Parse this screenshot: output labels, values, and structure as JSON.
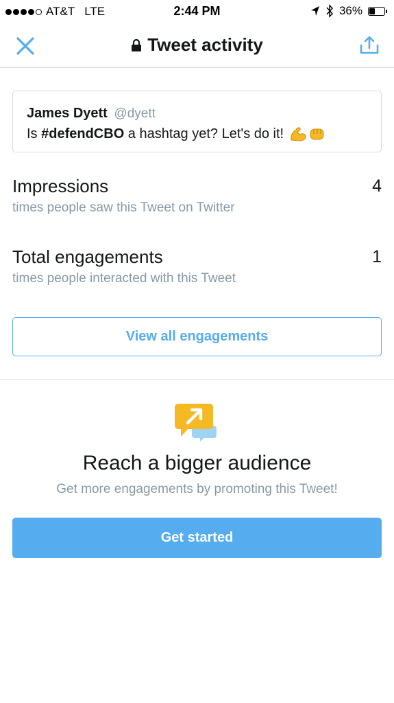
{
  "status_bar": {
    "carrier": "AT&T",
    "network": "LTE",
    "time": "2:44 PM",
    "battery_percent": "36%",
    "battery_level": 0.36,
    "signal_bars": 4,
    "signal_total": 5
  },
  "nav": {
    "title": "Tweet activity",
    "close_icon": "close-icon",
    "lock_icon": "lock-icon",
    "share_icon": "share-icon"
  },
  "tweet": {
    "author": "James Dyett",
    "handle": "@dyett",
    "text_before": "Is ",
    "hashtag": "#defendCBO",
    "text_after": " a hashtag yet? Let's do it!",
    "emojis": [
      "flexed-biceps-emoji",
      "fist-emoji"
    ]
  },
  "metrics": [
    {
      "label": "Impressions",
      "value": "4",
      "description": "times people saw this Tweet on Twitter"
    },
    {
      "label": "Total engagements",
      "value": "1",
      "description": "times people interacted with this Tweet"
    }
  ],
  "view_all_label": "View all engagements",
  "promo": {
    "icon": "promote-speech-icon",
    "title": "Reach a bigger audience",
    "subtitle": "Get more engagements by promoting this Tweet!",
    "button_label": "Get started"
  },
  "colors": {
    "accent": "#55acee",
    "text_primary": "#14171a",
    "text_secondary": "#8899a6",
    "border": "#d6d9dc",
    "promo_yellow": "#f5b924",
    "promo_blue": "#9fd3f4"
  }
}
